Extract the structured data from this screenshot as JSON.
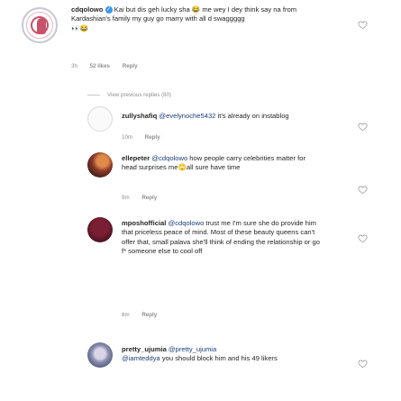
{
  "comment_main": {
    "username": "cdqolowo",
    "text": " Kai but dis geh lucky sha 😂 me wey I dey think say na from Kardashian's family my guy go marry with all d swaggggg",
    "emoji_line": "👀😂",
    "time": "3h",
    "likes": "52 likes",
    "reply": "Reply",
    "verified_icon": "verified-badge-icon"
  },
  "view_previous": "View previous replies (80)",
  "replies": [
    {
      "username": "zullyshafiq",
      "mention": "@evelynoche5432",
      "text": " it's already on instablog",
      "time": "10m",
      "reply": "Reply"
    },
    {
      "username": "ellepeter",
      "mention": "@cdqolowo",
      "text": " how people carry celebrities matter for head surprises me🙄all sure have time",
      "time": "9m",
      "reply": "Reply"
    },
    {
      "username": "mposhofficial",
      "mention": "@cdqolowo",
      "text": " trust me I'm sure she do provide him that priceless peace of mind. Most of these beauty queens can't offer that, small palava she'll think of ending the relationship or go f* someone else to cool off",
      "time": "8m",
      "reply": "Reply"
    },
    {
      "username": "pretty_ujumia",
      "mention": "@pretty_ujumia",
      "mention2": "@iamteddya",
      "text": " you should block him and his 49 likers",
      "time": "",
      "reply": ""
    }
  ],
  "colors": {
    "text": "#262626",
    "meta": "#8e8e8e",
    "mention": "#1a3d7a",
    "heart_stroke": "#8e8e8e"
  }
}
